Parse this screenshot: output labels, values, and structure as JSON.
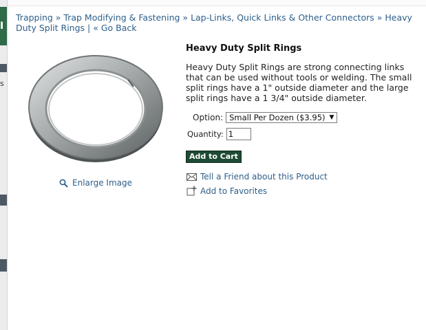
{
  "breadcrumb": {
    "items": [
      "Trapping",
      "Trap Modifying & Fastening",
      "Lap-Links, Quick Links & Other Connectors",
      "Heavy Duty Split Rings"
    ],
    "separator": "»",
    "pipe": "|",
    "back_label": "« Go Back"
  },
  "product": {
    "title": "Heavy Duty Split Rings",
    "description": "Heavy Duty Split Rings are strong connecting links that can be used without tools or welding.  The small split rings have a 1\" outside diameter and the large split rings have a 1 3/4\" outside diameter.",
    "image_icon": "split-ring-photo",
    "enlarge_label": "Enlarge Image"
  },
  "purchase": {
    "option_label": "Option:",
    "option_selected": "Small Per Dozen ($3.95)",
    "quantity_label": "Quantity:",
    "quantity_value": "1",
    "add_to_cart_label": "Add to Cart"
  },
  "actions": {
    "tell_friend_label": "Tell a Friend about this Product",
    "favorites_label": "Add to Favorites"
  },
  "sidebar_fragment": {
    "letter": "s",
    "glyph": "I"
  },
  "colors": {
    "link": "#2c5e8a",
    "button_bg": "#1e4a33",
    "sidebar_green": "#2e6b48"
  }
}
